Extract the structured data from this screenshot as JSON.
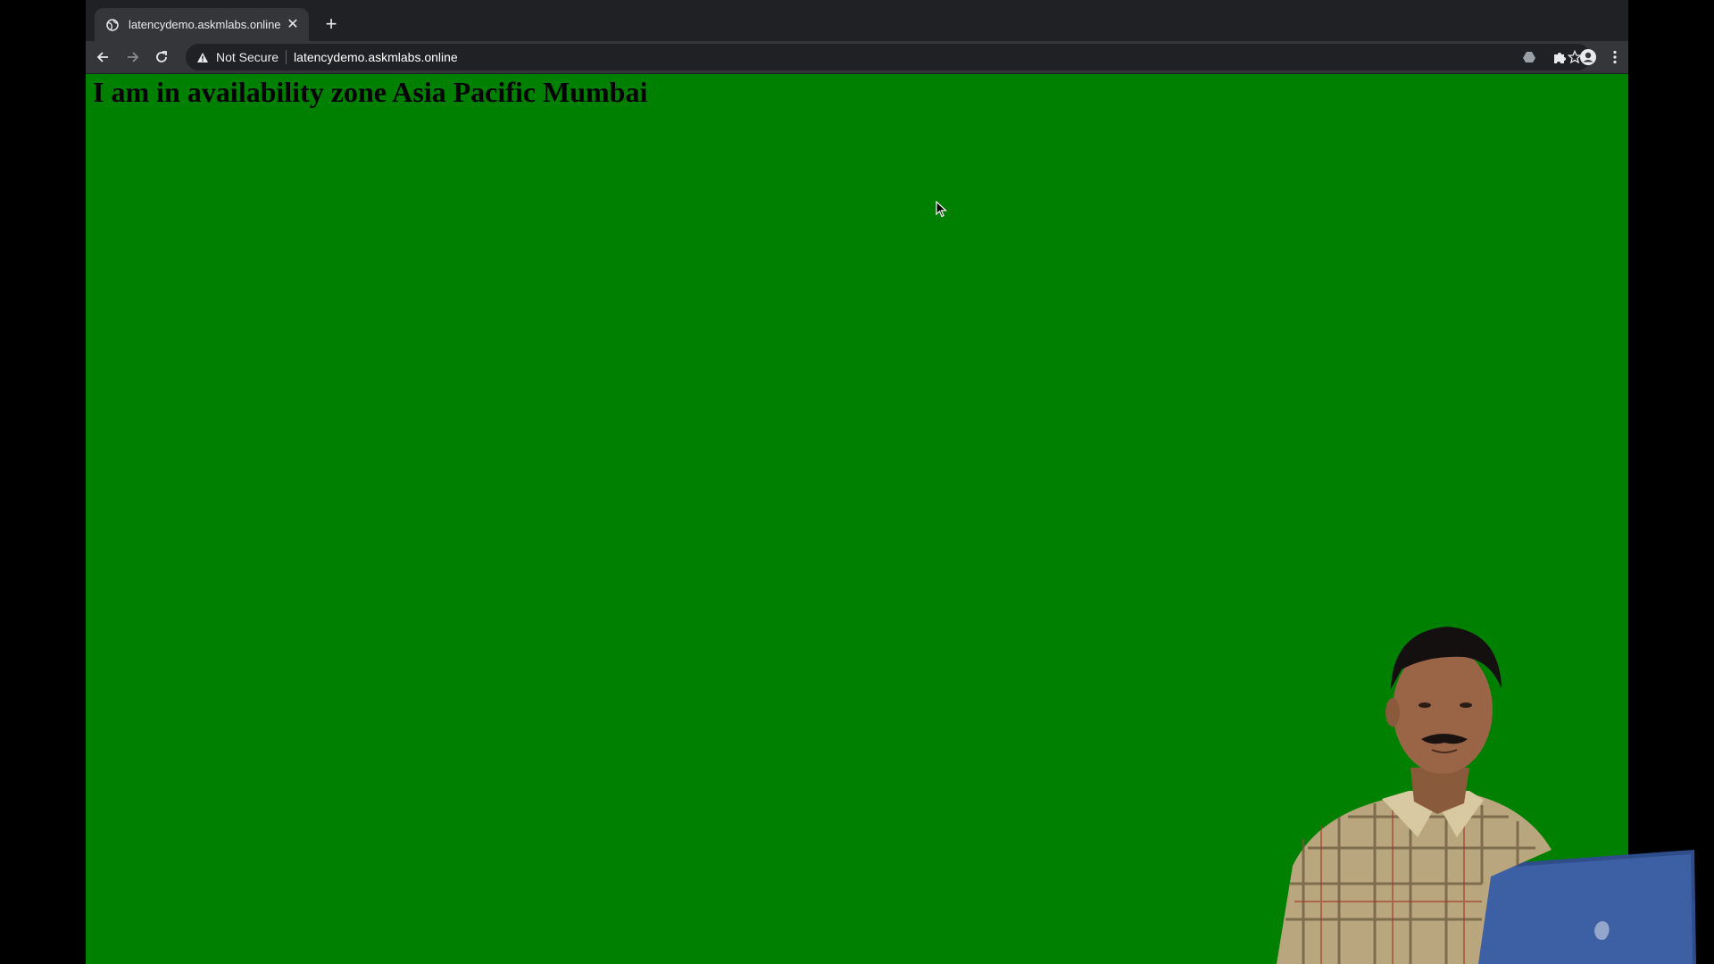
{
  "browser": {
    "tab": {
      "title": "latencydemo.askmlabs.online",
      "favicon": "globe-icon",
      "close_icon": "close-icon"
    },
    "new_tab_icon": "plus-icon",
    "toolbar": {
      "back_icon": "back-arrow-icon",
      "forward_icon": "forward-arrow-icon",
      "reload_icon": "reload-icon",
      "security_icon": "warning-triangle-icon",
      "security_label": "Not Secure",
      "url": "latencydemo.askmlabs.online",
      "bookmark_icon": "star-icon",
      "extension_icons": [
        "drive-icon",
        "puzzle-extensions-icon",
        "profile-avatar-icon",
        "kebab-menu-icon"
      ]
    }
  },
  "page": {
    "heading": "I am in availability zone Asia Pacific Mumbai",
    "background_color": "#008000"
  },
  "overlay": {
    "presenter": "presenter-webcam-overlay"
  },
  "colors": {
    "tabstrip": "#202124",
    "toolbar": "#35363a",
    "omnibox": "#202124",
    "page_bg": "#008000",
    "outer_bg": "#000000"
  }
}
